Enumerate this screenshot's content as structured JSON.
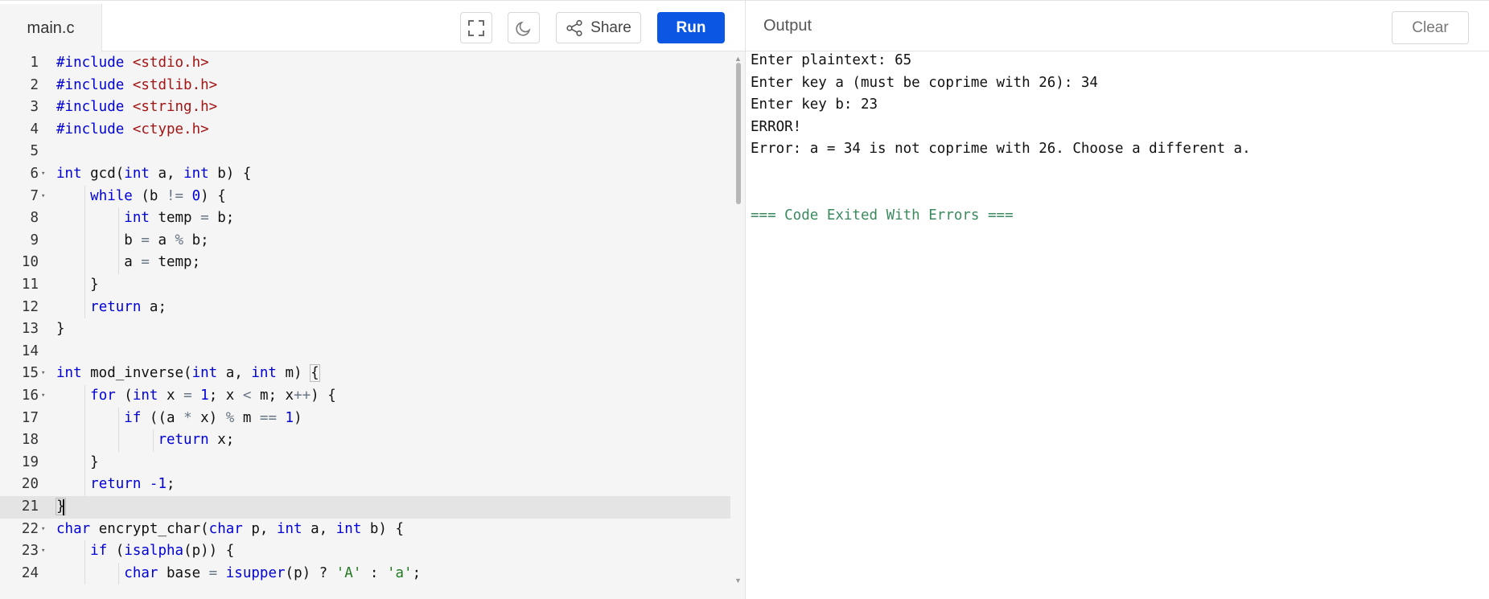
{
  "editor": {
    "file_tab": "main.c",
    "share_label": "Share",
    "run_label": "Run",
    "active_line": 21,
    "lines": [
      {
        "n": "1",
        "segs": [
          [
            "kw",
            "#include"
          ],
          [
            "",
            " "
          ],
          [
            "str",
            "<stdio.h>"
          ]
        ]
      },
      {
        "n": "2",
        "segs": [
          [
            "kw",
            "#include"
          ],
          [
            "",
            " "
          ],
          [
            "str",
            "<stdlib.h>"
          ]
        ]
      },
      {
        "n": "3",
        "segs": [
          [
            "kw",
            "#include"
          ],
          [
            "",
            " "
          ],
          [
            "str",
            "<string.h>"
          ]
        ]
      },
      {
        "n": "4",
        "segs": [
          [
            "kw",
            "#include"
          ],
          [
            "",
            " "
          ],
          [
            "str",
            "<ctype.h>"
          ]
        ]
      },
      {
        "n": "5",
        "segs": []
      },
      {
        "n": "6",
        "fold": true,
        "segs": [
          [
            "kw",
            "int"
          ],
          [
            "",
            " gcd("
          ],
          [
            "kw",
            "int"
          ],
          [
            "",
            " a, "
          ],
          [
            "kw",
            "int"
          ],
          [
            "",
            " b) {"
          ]
        ]
      },
      {
        "n": "7",
        "fold": true,
        "indent": 1,
        "segs": [
          [
            "",
            "    "
          ],
          [
            "kw",
            "while"
          ],
          [
            "",
            " (b "
          ],
          [
            "op",
            "!="
          ],
          [
            "",
            " "
          ],
          [
            "num",
            "0"
          ],
          [
            "",
            ") {"
          ]
        ]
      },
      {
        "n": "8",
        "indent": 2,
        "segs": [
          [
            "",
            "        "
          ],
          [
            "kw",
            "int"
          ],
          [
            "",
            " temp "
          ],
          [
            "op",
            "="
          ],
          [
            "",
            " b;"
          ]
        ]
      },
      {
        "n": "9",
        "indent": 2,
        "segs": [
          [
            "",
            "        b "
          ],
          [
            "op",
            "="
          ],
          [
            "",
            " a "
          ],
          [
            "op",
            "%"
          ],
          [
            "",
            " b;"
          ]
        ]
      },
      {
        "n": "10",
        "indent": 2,
        "segs": [
          [
            "",
            "        a "
          ],
          [
            "op",
            "="
          ],
          [
            "",
            " temp;"
          ]
        ]
      },
      {
        "n": "11",
        "indent": 1,
        "segs": [
          [
            "",
            "    }"
          ]
        ]
      },
      {
        "n": "12",
        "indent": 1,
        "segs": [
          [
            "",
            "    "
          ],
          [
            "kw",
            "return"
          ],
          [
            "",
            " a;"
          ]
        ]
      },
      {
        "n": "13",
        "segs": [
          [
            "",
            "}"
          ]
        ]
      },
      {
        "n": "14",
        "segs": []
      },
      {
        "n": "15",
        "fold": true,
        "segs": [
          [
            "kw",
            "int"
          ],
          [
            "",
            " mod_inverse("
          ],
          [
            "kw",
            "int"
          ],
          [
            "",
            " a, "
          ],
          [
            "kw",
            "int"
          ],
          [
            "",
            " m) "
          ],
          [
            "box",
            "{"
          ]
        ]
      },
      {
        "n": "16",
        "fold": true,
        "indent": 1,
        "segs": [
          [
            "",
            "    "
          ],
          [
            "kw",
            "for"
          ],
          [
            "",
            " ("
          ],
          [
            "kw",
            "int"
          ],
          [
            "",
            " x "
          ],
          [
            "op",
            "="
          ],
          [
            "",
            " "
          ],
          [
            "num",
            "1"
          ],
          [
            "",
            "; x "
          ],
          [
            "op",
            "<"
          ],
          [
            "",
            " m; x"
          ],
          [
            "op",
            "++"
          ],
          [
            "",
            ") {"
          ]
        ]
      },
      {
        "n": "17",
        "indent": 2,
        "segs": [
          [
            "",
            "        "
          ],
          [
            "kw",
            "if"
          ],
          [
            "",
            " ((a "
          ],
          [
            "op",
            "*"
          ],
          [
            "",
            " x) "
          ],
          [
            "op",
            "%"
          ],
          [
            "",
            " m "
          ],
          [
            "op",
            "=="
          ],
          [
            "",
            " "
          ],
          [
            "num",
            "1"
          ],
          [
            "",
            ")"
          ]
        ]
      },
      {
        "n": "18",
        "indent": 3,
        "segs": [
          [
            "",
            "            "
          ],
          [
            "kw",
            "return"
          ],
          [
            "",
            " x;"
          ]
        ]
      },
      {
        "n": "19",
        "indent": 1,
        "segs": [
          [
            "",
            "    }"
          ]
        ]
      },
      {
        "n": "20",
        "indent": 1,
        "segs": [
          [
            "",
            "    "
          ],
          [
            "kw",
            "return"
          ],
          [
            "",
            " "
          ],
          [
            "num",
            "-1"
          ],
          [
            "",
            ";"
          ]
        ]
      },
      {
        "n": "21",
        "segs": [
          [
            "box",
            "}"
          ]
        ]
      },
      {
        "n": "22",
        "fold": true,
        "segs": [
          [
            "kw",
            "char"
          ],
          [
            "",
            " encrypt_char("
          ],
          [
            "kw",
            "char"
          ],
          [
            "",
            " p, "
          ],
          [
            "kw",
            "int"
          ],
          [
            "",
            " a, "
          ],
          [
            "kw",
            "int"
          ],
          [
            "",
            " b) {"
          ]
        ]
      },
      {
        "n": "23",
        "fold": true,
        "indent": 1,
        "segs": [
          [
            "",
            "    "
          ],
          [
            "kw",
            "if"
          ],
          [
            "",
            " ("
          ],
          [
            "kw",
            "isalpha"
          ],
          [
            "",
            "(p)) {"
          ]
        ]
      },
      {
        "n": "24",
        "indent": 2,
        "segs": [
          [
            "",
            "        "
          ],
          [
            "kw",
            "char"
          ],
          [
            "",
            " base "
          ],
          [
            "op",
            "="
          ],
          [
            "",
            " "
          ],
          [
            "kw",
            "isupper"
          ],
          [
            "",
            "(p) ? "
          ],
          [
            "chr",
            "'A'"
          ],
          [
            "",
            " : "
          ],
          [
            "chr",
            "'a'"
          ],
          [
            "",
            ";"
          ]
        ]
      }
    ]
  },
  "output": {
    "title": "Output",
    "clear_label": "Clear",
    "lines": [
      "Enter plaintext: 65",
      "Enter key a (must be coprime with 26): 34",
      "Enter key b: 23",
      "ERROR!",
      "Error: a = 34 is not coprime with 26. Choose a different a."
    ],
    "exit_message": "=== Code Exited With Errors ==="
  },
  "icons": {
    "fullscreen": "fullscreen-icon",
    "theme": "moon-icon",
    "share": "share-icon"
  },
  "colors": {
    "run_button": "#0b57e3",
    "keyword": "#0000d8",
    "string": "#a31515",
    "char_literal": "#1f7a1f",
    "exit_message": "#3a8a5e",
    "active_line": "#e4e4e4"
  }
}
